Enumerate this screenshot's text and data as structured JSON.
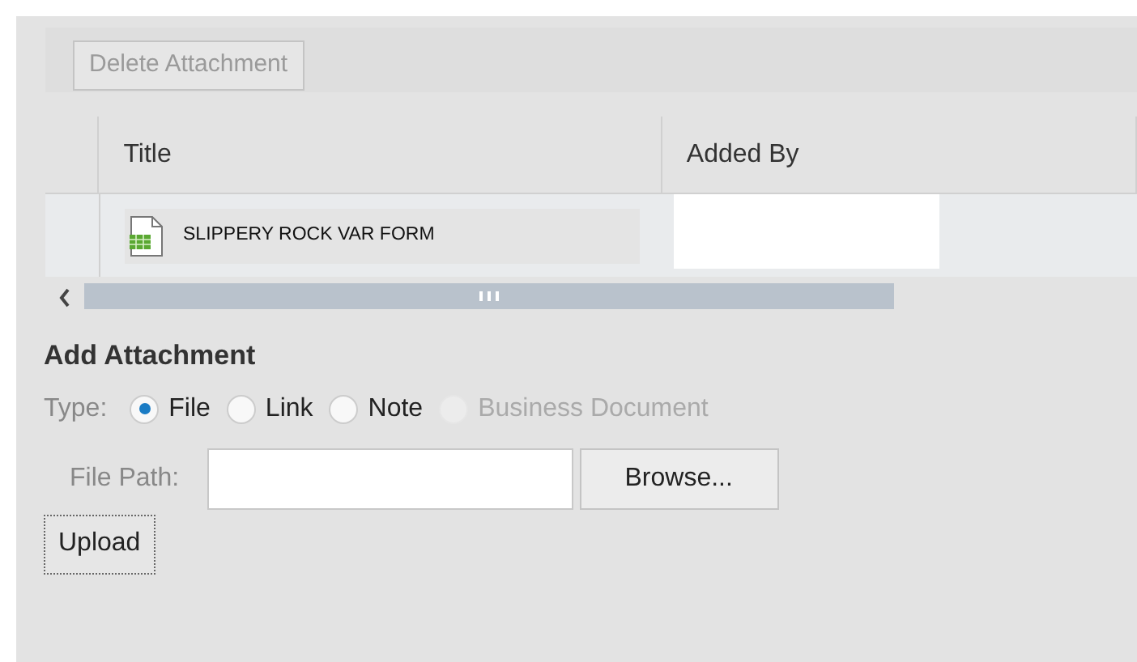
{
  "toolbar": {
    "delete_button": {
      "label": "Delete Attachment",
      "disabled": true
    }
  },
  "table": {
    "columns": [
      "Title",
      "Added By"
    ],
    "rows": [
      {
        "title": "SLIPPERY ROCK VAR FORM",
        "added_by_redacted": true
      }
    ]
  },
  "add_attachment": {
    "heading": "Add Attachment",
    "type_label": "Type:",
    "types": [
      {
        "label": "File",
        "selected": true,
        "disabled": false
      },
      {
        "label": "Link",
        "selected": false,
        "disabled": false
      },
      {
        "label": "Note",
        "selected": false,
        "disabled": false
      },
      {
        "label": "Business Document",
        "selected": false,
        "disabled": true
      }
    ],
    "file_path_label": "File Path:",
    "browse_button": "Browse...",
    "upload_button": "Upload"
  }
}
